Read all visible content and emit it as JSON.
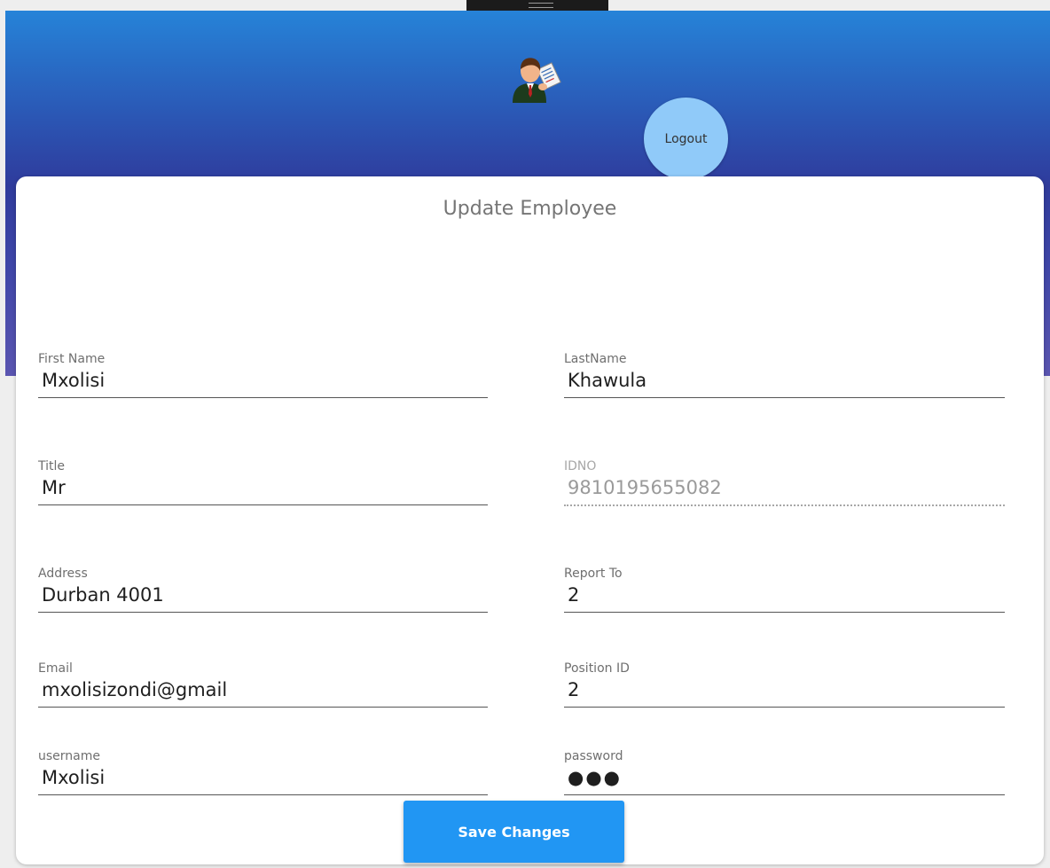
{
  "header": {
    "logout_label": "Logout"
  },
  "form": {
    "title": "Update Employee",
    "fields": [
      {
        "label": "First Name",
        "value": "Mxolisi"
      },
      {
        "label": "LastName",
        "value": "Khawula"
      },
      {
        "label": "Title",
        "value": "Mr"
      },
      {
        "label": "IDNO",
        "value": "9810195655082"
      },
      {
        "label": "Address",
        "value": "Durban 4001"
      },
      {
        "label": "Report To",
        "value": "2"
      },
      {
        "label": "Email",
        "value": "mxolisizondi@gmail"
      },
      {
        "label": "Position ID",
        "value": "2"
      },
      {
        "label": "username",
        "value": "Mxolisi"
      },
      {
        "label": "password",
        "value": "●●●"
      }
    ],
    "save_label": "Save Changes"
  },
  "colors": {
    "header_top": "#2683d8",
    "header_bottom": "#3f46a8",
    "logout_bg": "#90caf9",
    "save_bg": "#2196f3"
  },
  "icons": {
    "avatar": "businessman-with-document-icon"
  }
}
